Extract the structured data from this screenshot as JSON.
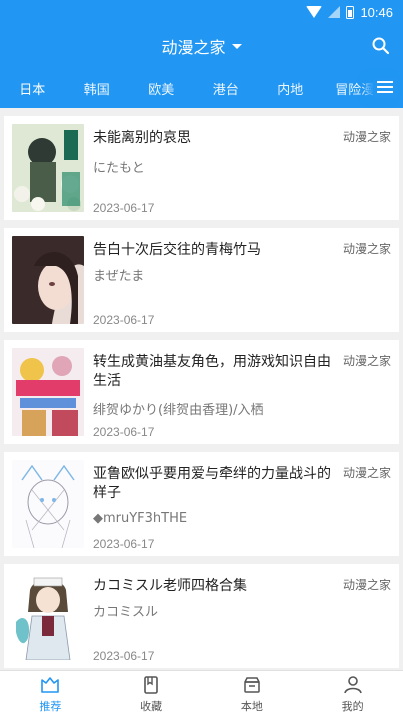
{
  "status": {
    "time": "10:46"
  },
  "header": {
    "title": "动漫之家"
  },
  "tabs": [
    "日本",
    "韩国",
    "欧美",
    "港台",
    "内地",
    "冒险漫"
  ],
  "items": [
    {
      "title": "未能离别的哀思",
      "author": "にたもと",
      "date": "2023-06-17",
      "source": "动漫之家"
    },
    {
      "title": "告白十次后交往的青梅竹马",
      "author": "まぜたま",
      "date": "2023-06-17",
      "source": "动漫之家"
    },
    {
      "title": "转生成黄油基友角色，用游戏知识自由生活",
      "author": "绯贺ゆかり(绯贺由香理)/入栖",
      "date": "2023-06-17",
      "source": "动漫之家"
    },
    {
      "title": "亚鲁欧似乎要用爱与牵绊的力量战斗的样子",
      "author": "◆mruYF3hTHE",
      "date": "2023-06-17",
      "source": "动漫之家"
    },
    {
      "title": "カコミスル老师四格合集",
      "author": "カコミスル",
      "date": "2023-06-17",
      "source": "动漫之家"
    }
  ],
  "bottom_nav": [
    {
      "label": "推荐",
      "icon": "recommend-icon"
    },
    {
      "label": "收藏",
      "icon": "bookmark-icon"
    },
    {
      "label": "本地",
      "icon": "local-storage-icon"
    },
    {
      "label": "我的",
      "icon": "profile-icon"
    }
  ],
  "colors": {
    "primary": "#2196f3"
  }
}
